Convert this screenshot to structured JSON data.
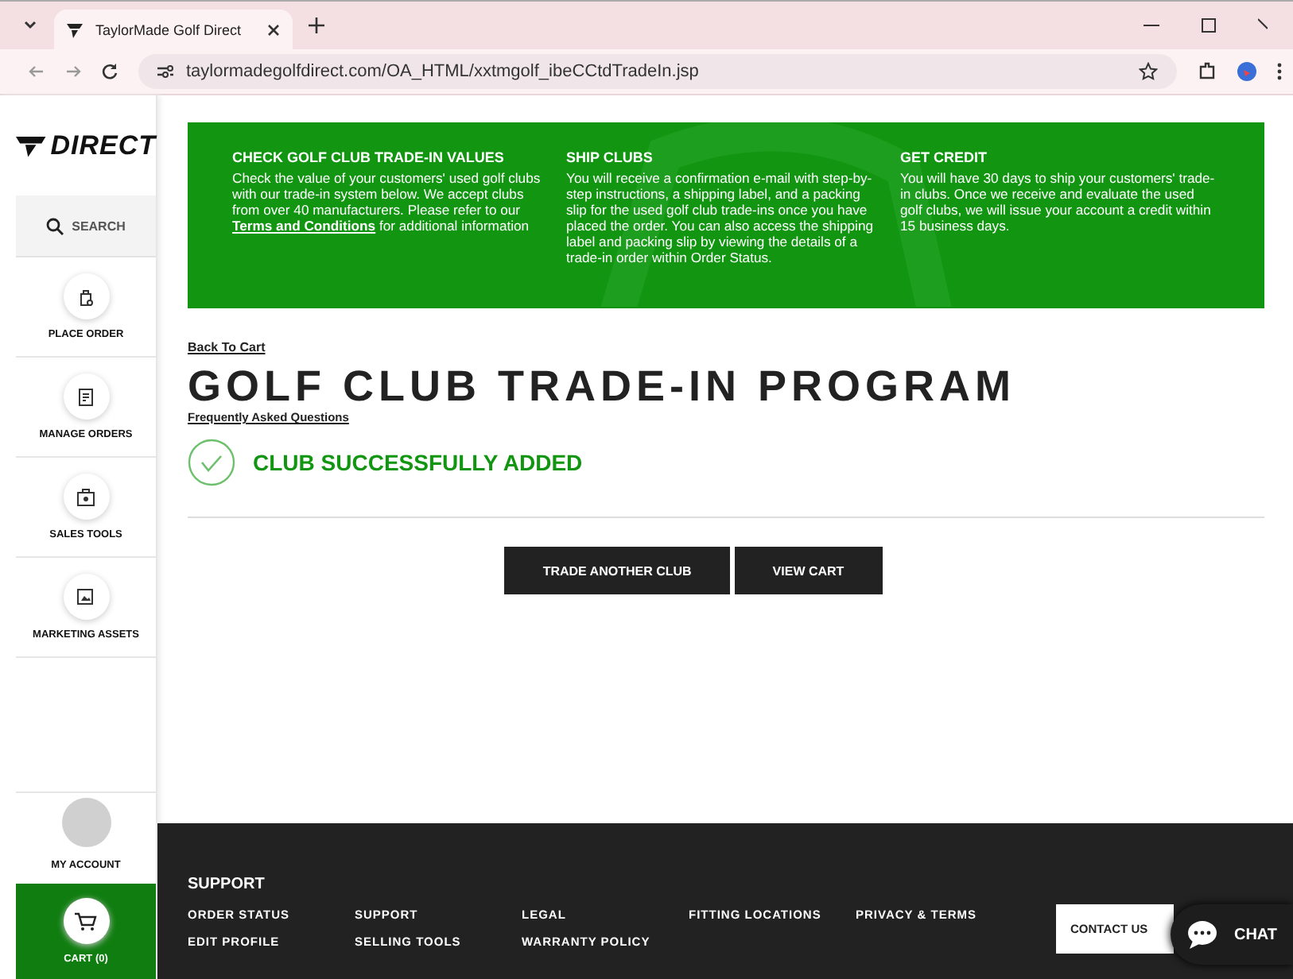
{
  "browser": {
    "tab_title": "TaylorMade Golf Direct",
    "url": "taylormadegolfdirect.com/OA_HTML/xxtmgolf_ibeCCtdTradeIn.jsp"
  },
  "sidebar": {
    "logo": "DIRECT",
    "search": "SEARCH",
    "items": [
      {
        "label": "PLACE ORDER",
        "kind": "bag"
      },
      {
        "label": "MANAGE ORDERS",
        "kind": "list"
      },
      {
        "label": "SALES TOOLS",
        "kind": "case"
      },
      {
        "label": "MARKETING ASSETS",
        "kind": "image"
      }
    ],
    "account": "MY ACCOUNT",
    "cart": "CART (0)"
  },
  "banner": [
    {
      "title": "CHECK GOLF CLUB TRADE-IN VALUES",
      "text": "Check the value of your customers' used golf clubs with our trade-in system below. We accept clubs from over 40 manufacturers. Please refer to our **Terms and Conditions** for additional information"
    },
    {
      "title": "SHIP CLUBS",
      "text": "You will receive a confirmation e-mail with step-by-step instructions, a shipping label, and a packing slip for the used golf club trade-ins once you have placed the order. You can also access the shipping label and packing slip by viewing the details of a trade-in order within Order Status."
    },
    {
      "title": "GET CREDIT",
      "text": "You will have 30 days to ship your customers' trade-in clubs. Once we receive and evaluate the used golf clubs, we will issue your account a credit within 15 business days."
    }
  ],
  "back_link": "Back To Cart",
  "heading": "GOLF CLUB TRADE-IN PROGRAM",
  "faq_link": "Frequently Asked Questions",
  "message": "CLUB SUCCESSFULLY ADDED",
  "buttons": [
    "TRADE ANOTHER CLUB",
    "VIEW CART"
  ],
  "footer": {
    "title": "SUPPORT",
    "links": [
      [
        "ORDER STATUS",
        "EDIT PROFILE"
      ],
      [
        "SUPPORT",
        "SELLING TOOLS"
      ],
      [
        "LEGAL",
        "WARRANTY POLICY"
      ],
      [
        "FITTING LOCATIONS"
      ],
      [
        "PRIVACY & TERMS"
      ]
    ],
    "contact": "CONTACT US",
    "chat": "CHAT"
  }
}
